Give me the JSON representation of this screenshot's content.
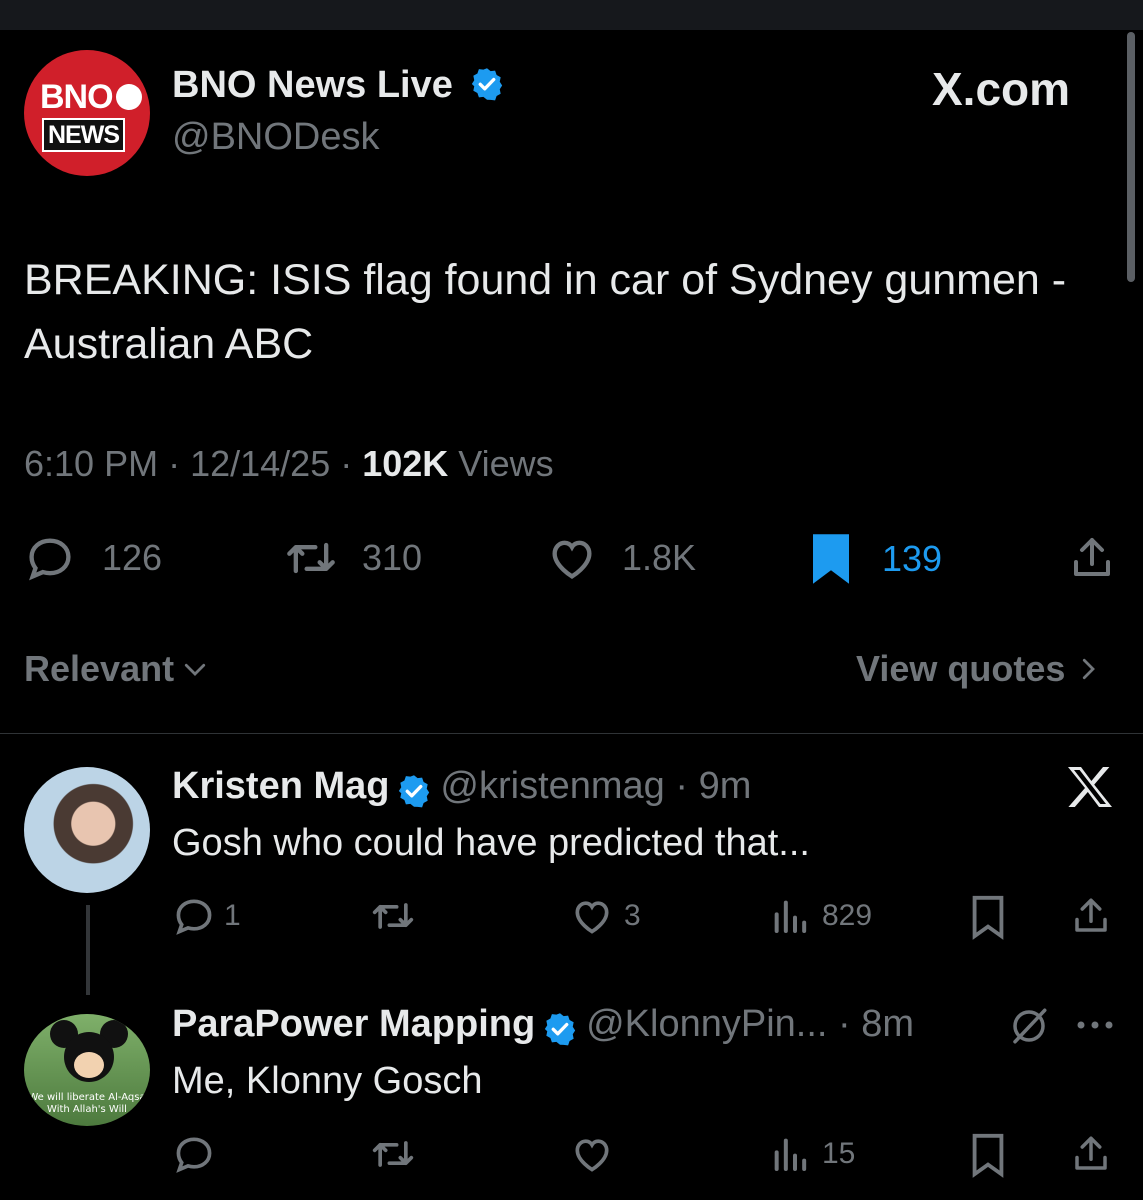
{
  "colors": {
    "background": "#000000",
    "text": "#e7e9ea",
    "muted": "#71767b",
    "accent": "#1d9bf0",
    "bno_red": "#d01f2a"
  },
  "header": {
    "brand": "X.com"
  },
  "main_post": {
    "avatar_logo": {
      "line1": "BNO",
      "line2": "NEWS"
    },
    "author_name": "BNO News Live",
    "handle": "@BNODesk",
    "text": "BREAKING: ISIS flag found in car of Sydney gunmen - Australian ABC",
    "time": "6:10 PM",
    "date": "12/14/25",
    "views_count": "102K",
    "views_label": "Views",
    "stats": {
      "replies": "126",
      "reposts": "310",
      "likes": "1.8K",
      "bookmarks": "139"
    },
    "icons": [
      "reply-icon",
      "repost-icon",
      "like-icon",
      "bookmark-icon-filled",
      "share-icon"
    ]
  },
  "sort": {
    "label": "Relevant",
    "view_quotes": "View quotes"
  },
  "replies": [
    {
      "author_name": "Kristen Mag",
      "handle": "@kristenmag",
      "age": "9m",
      "text": "Gosh who could have predicted that...",
      "stats": {
        "replies": "1",
        "reposts": "",
        "likes": "3",
        "views": "829"
      }
    },
    {
      "author_name": "ParaPower Mapping",
      "handle": "@KlonnyPin...",
      "age": "8m",
      "text": "Me, Klonny Gosch",
      "avatar_caption": "We will liberate Al-Aqsa With Allah's Will",
      "stats": {
        "replies": "",
        "reposts": "",
        "likes": "",
        "views": "15"
      }
    }
  ]
}
